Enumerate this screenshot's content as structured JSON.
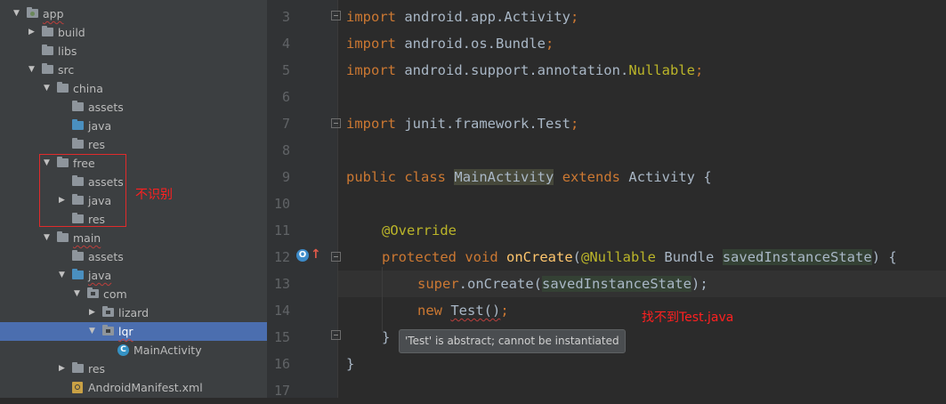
{
  "project_tree": {
    "items": [
      {
        "label": "app",
        "depth": 0,
        "arrow": "down",
        "icon": "app-module-folder",
        "selected": false
      },
      {
        "label": "build",
        "depth": 1,
        "arrow": "right",
        "icon": "folder-gray",
        "selected": false
      },
      {
        "label": "libs",
        "depth": 1,
        "arrow": "",
        "icon": "folder-gray",
        "selected": false
      },
      {
        "label": "src",
        "depth": 1,
        "arrow": "down",
        "icon": "folder-gray",
        "selected": false
      },
      {
        "label": "china",
        "depth": 2,
        "arrow": "down",
        "icon": "folder-gray",
        "selected": false
      },
      {
        "label": "assets",
        "depth": 3,
        "arrow": "",
        "icon": "folder-gray",
        "selected": false
      },
      {
        "label": "java",
        "depth": 3,
        "arrow": "",
        "icon": "folder-blue",
        "selected": false
      },
      {
        "label": "res",
        "depth": 3,
        "arrow": "",
        "icon": "folder-gray",
        "selected": false
      },
      {
        "label": "free",
        "depth": 2,
        "arrow": "down",
        "icon": "folder-gray",
        "selected": false
      },
      {
        "label": "assets",
        "depth": 3,
        "arrow": "",
        "icon": "folder-gray",
        "selected": false
      },
      {
        "label": "java",
        "depth": 3,
        "arrow": "right",
        "icon": "folder-gray",
        "selected": false
      },
      {
        "label": "res",
        "depth": 3,
        "arrow": "",
        "icon": "folder-gray",
        "selected": false
      },
      {
        "label": "main",
        "depth": 2,
        "arrow": "down",
        "icon": "folder-gray",
        "selected": false
      },
      {
        "label": "assets",
        "depth": 3,
        "arrow": "",
        "icon": "folder-gray",
        "selected": false
      },
      {
        "label": "java",
        "depth": 3,
        "arrow": "down",
        "icon": "folder-blue",
        "selected": false
      },
      {
        "label": "com",
        "depth": 4,
        "arrow": "down",
        "icon": "package-folder",
        "selected": false
      },
      {
        "label": "lizard",
        "depth": 5,
        "arrow": "right",
        "icon": "package-folder",
        "selected": false
      },
      {
        "label": "lqr",
        "depth": 5,
        "arrow": "down",
        "icon": "package-folder",
        "selected": true
      },
      {
        "label": "MainActivity",
        "depth": 6,
        "arrow": "",
        "icon": "class-c",
        "selected": false
      },
      {
        "label": "res",
        "depth": 3,
        "arrow": "right",
        "icon": "folder-gray",
        "selected": false
      },
      {
        "label": "AndroidManifest.xml",
        "depth": 3,
        "arrow": "",
        "icon": "xml-file",
        "selected": false
      }
    ]
  },
  "annotations": {
    "free_note": "不识别",
    "test_note": "找不到Test.java"
  },
  "editor": {
    "line_numbers": [
      "3",
      "4",
      "5",
      "6",
      "7",
      "8",
      "9",
      "10",
      "11",
      "12",
      "13",
      "14",
      "15",
      "16",
      "17"
    ],
    "tokens": {
      "import": "import",
      "l3_pkg": "android.app.Activity",
      "l4_pkg": "android.os.Bundle",
      "l5_pkg": "android.support.annotation.",
      "l5_nullable": "Nullable",
      "l7_pkg": "junit.framework.Test",
      "semicolon": ";",
      "public": "public",
      "class": "class",
      "main_activity": "MainActivity",
      "extends": "extends",
      "activity_brace": "Activity {",
      "override": "@Override",
      "protected": "protected",
      "void": "void",
      "on_create": "onCreate",
      "paren_open": "(",
      "nullable_ann": "@Nullable",
      "bundle": "Bundle",
      "saved_state": "savedInstanceState",
      "paren_close_brace": ") {",
      "super": "super",
      "dot_on_create": ".onCreate(",
      "paren_close_semi": ");",
      "new": "new",
      "test_ctor": "Test()",
      "close_brace": "}"
    },
    "tooltip": "'Test' is abstract; cannot be instantiated",
    "override_marker": "O"
  },
  "colors": {
    "keyword": "#cc7832",
    "annotation": "#bbb529",
    "method": "#ffc66d",
    "default_text": "#a9b7c6",
    "selection": "#4b6eaf",
    "error_red": "#ff2020"
  }
}
